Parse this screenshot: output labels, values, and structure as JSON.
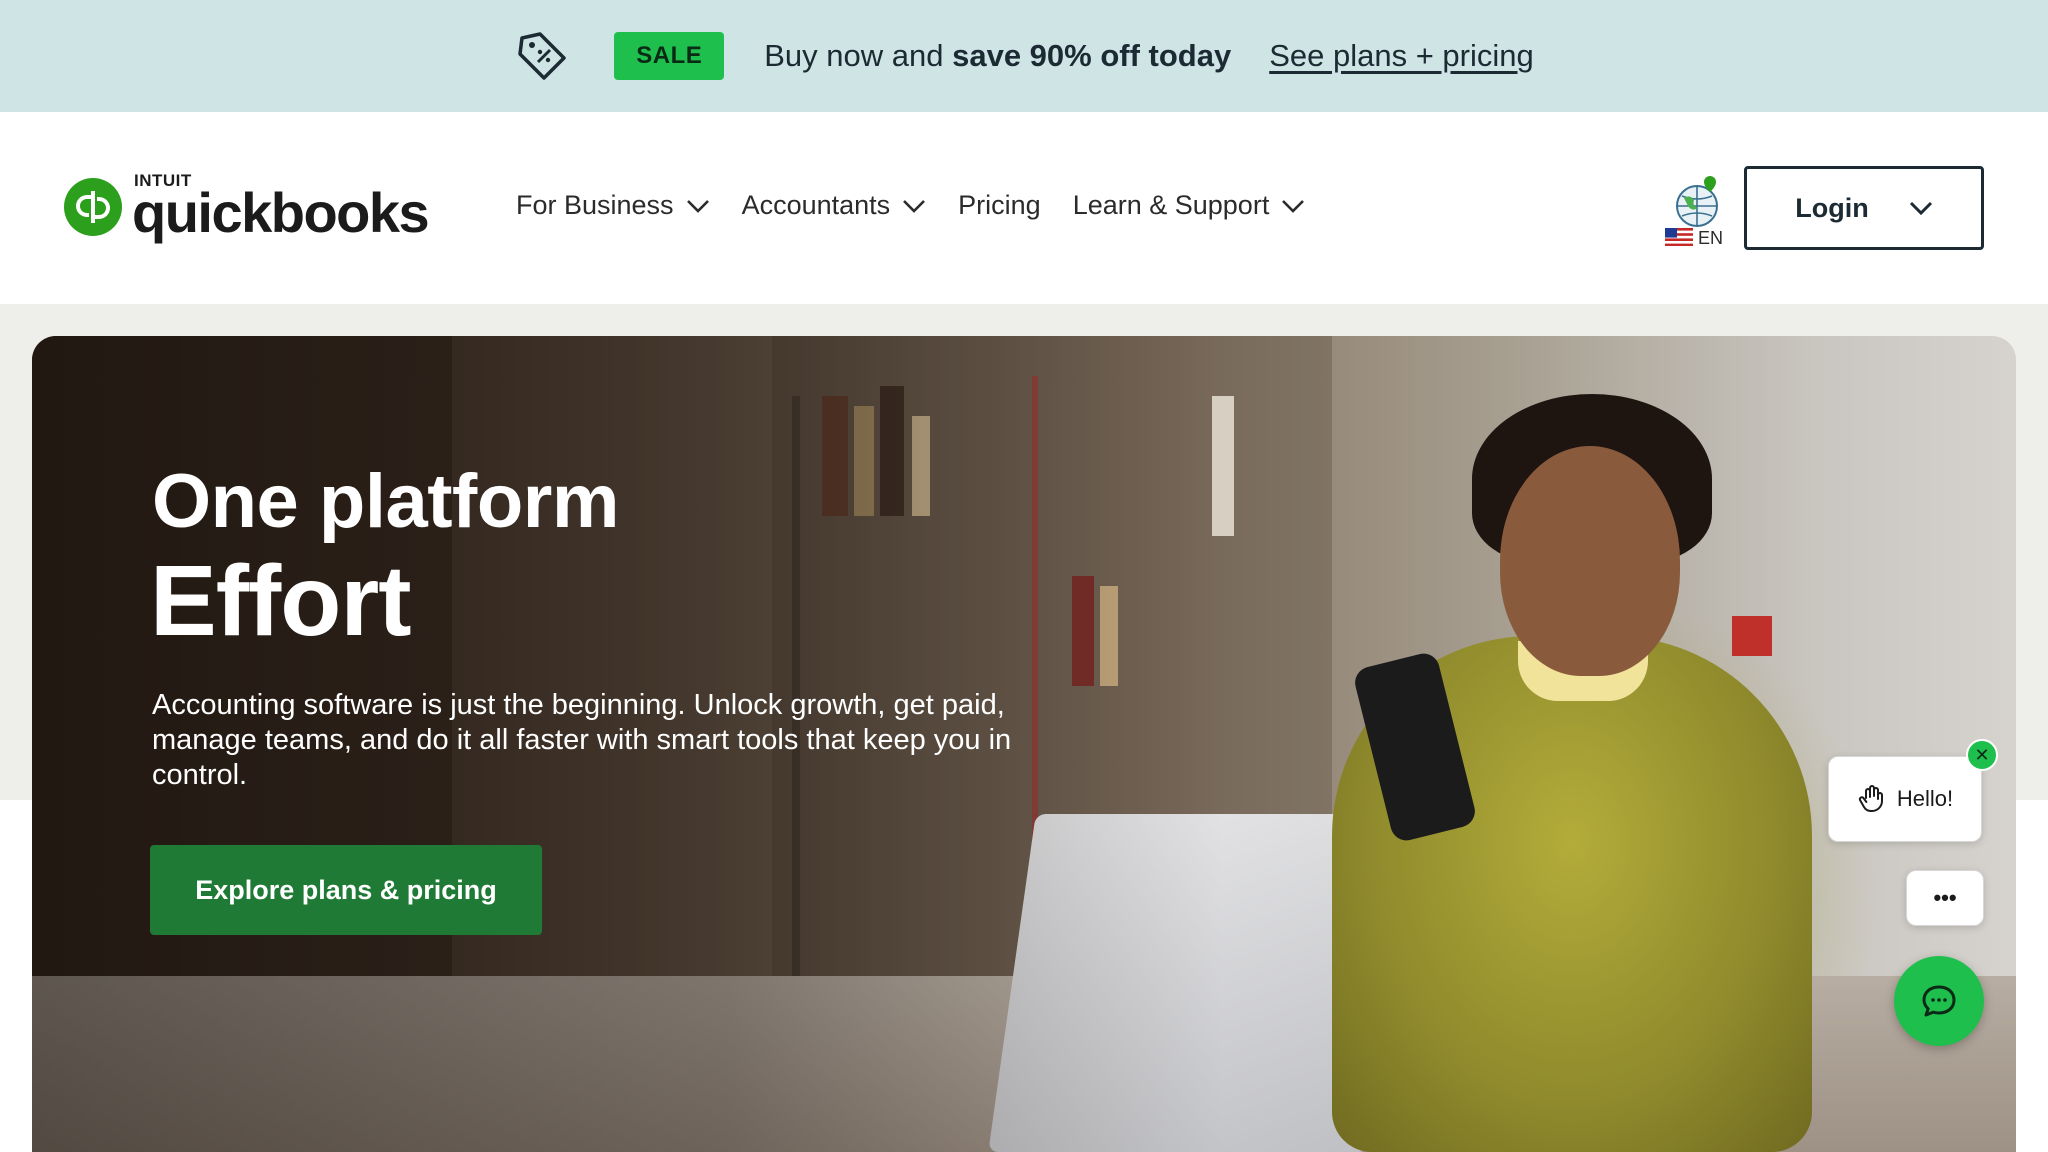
{
  "promo": {
    "tag_icon": "price-tag-icon",
    "badge": "SALE",
    "text_prefix": "Buy now and ",
    "text_bold": "save 90% off today",
    "link": "See plans + pricing"
  },
  "header": {
    "logo": {
      "brand_small": "INTUIT",
      "brand_large": "quickbooks"
    },
    "nav": [
      {
        "label": "For Business",
        "dropdown": true
      },
      {
        "label": "Accountants",
        "dropdown": true
      },
      {
        "label": "Pricing",
        "dropdown": false
      },
      {
        "label": "Learn & Support",
        "dropdown": true
      }
    ],
    "locale": {
      "icon": "globe-icon",
      "flag": "us-flag-icon",
      "language": "EN"
    },
    "login": {
      "label": "Login",
      "icon": "chevron-down-icon"
    }
  },
  "hero": {
    "title_line1": "One platform",
    "title_line2": "Effort",
    "description": "Accounting software is just the beginning. Unlock growth, get paid, manage teams, and do it all faster with smart tools that keep you in control.",
    "cta": "Explore plans & pricing"
  },
  "chat": {
    "greeting": "Hello!",
    "greeting_icon": "waving-hand-icon",
    "close_icon": "close-icon",
    "more": "•••",
    "fab_icon": "chat-bubble-icon"
  },
  "colors": {
    "promo_bg": "#cfe4e4",
    "sale_green": "#1fbf4e",
    "brand_green": "#2ca01c",
    "cta_green": "#1f7a35",
    "ink": "#1b2a33"
  }
}
